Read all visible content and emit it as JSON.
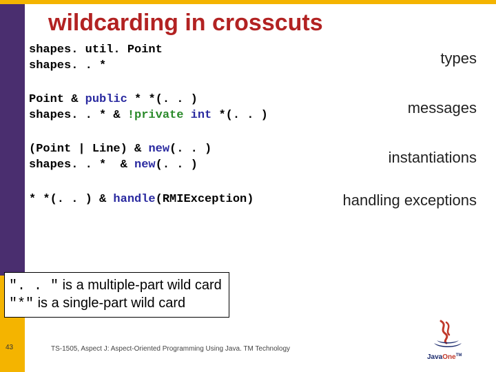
{
  "title": "wildcarding in crosscuts",
  "blocks": [
    {
      "lines": [
        [
          {
            "t": "shapes. util. Point"
          }
        ],
        [
          {
            "t": "shapes. . *"
          }
        ]
      ],
      "label": "types"
    },
    {
      "lines": [
        [
          {
            "t": "Point & "
          },
          {
            "t": "public",
            "cls": "kw"
          },
          {
            "t": " * *(. . )"
          }
        ],
        [
          {
            "t": "shapes. . * & "
          },
          {
            "t": "!private",
            "cls": "neg"
          },
          {
            "t": " "
          },
          {
            "t": "int",
            "cls": "kw"
          },
          {
            "t": " *(. . )"
          }
        ]
      ],
      "label": "messages"
    },
    {
      "lines": [
        [
          {
            "t": "(Point | Line) & "
          },
          {
            "t": "new",
            "cls": "kw"
          },
          {
            "t": "(. . )"
          }
        ],
        [
          {
            "t": "shapes. . *  & "
          },
          {
            "t": "new",
            "cls": "kw"
          },
          {
            "t": "(. . )"
          }
        ]
      ],
      "label": "instantiations"
    },
    {
      "lines": [
        [
          {
            "t": "* *(. . ) & "
          },
          {
            "t": "handle",
            "cls": "kw"
          },
          {
            "t": "(RMIException)"
          }
        ]
      ],
      "label": "handling exceptions"
    }
  ],
  "note": {
    "line1_q": "\". . \"",
    "line1_rest": " is a multiple-part wild card",
    "line2_q": "\"*\"",
    "line2_rest": " is a single-part wild card"
  },
  "footer": "TS-1505, Aspect J: Aspect-Oriented Programming Using Java. TM Technology",
  "slide_num": "43",
  "logo": {
    "brand": "Java",
    "suffix": "One",
    "tm": "TM"
  }
}
